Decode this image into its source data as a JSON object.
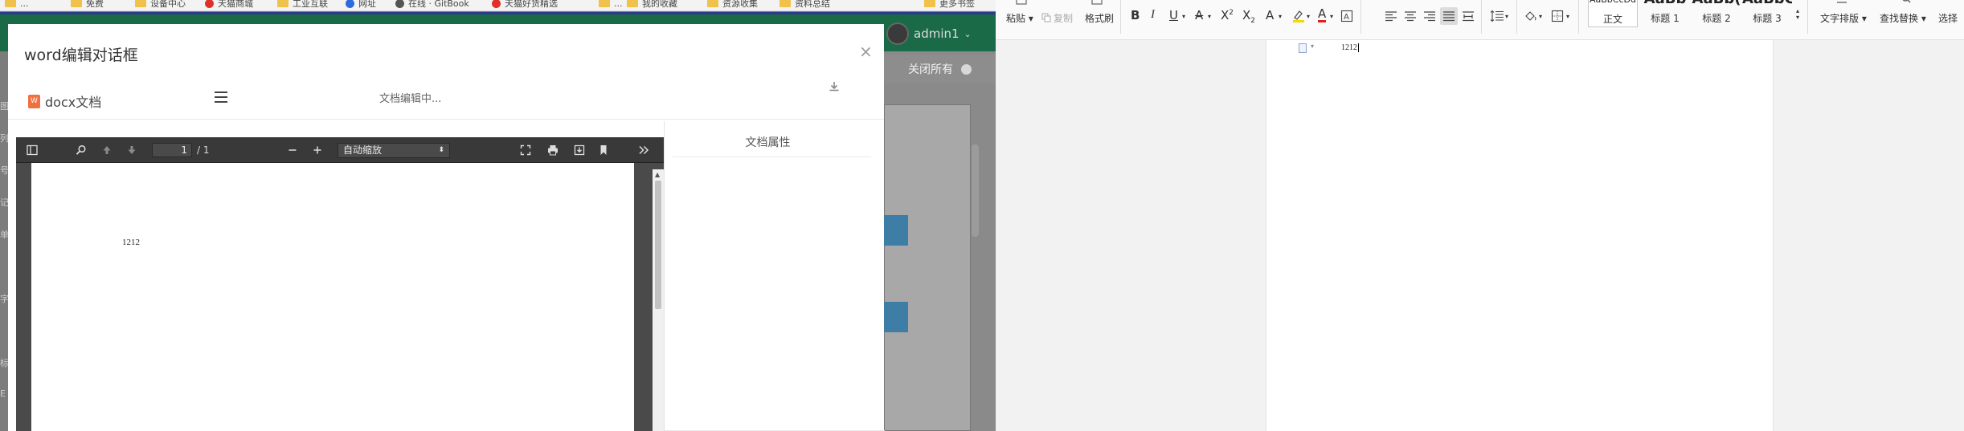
{
  "browser": {
    "bookmarks": [
      {
        "label": "...",
        "type": "folder"
      },
      {
        "label": "免费",
        "type": "folder"
      },
      {
        "label": "设备中心",
        "type": "folder"
      },
      {
        "label": "天猫商城",
        "type": "site"
      },
      {
        "label": "工业互联",
        "type": "folder"
      },
      {
        "label": "网址",
        "type": "site"
      },
      {
        "label": "在线 · GitBook",
        "type": "site"
      },
      {
        "label": "天猫好货精选",
        "type": "site"
      },
      {
        "label": "...",
        "type": "folder"
      },
      {
        "label": "我的收藏",
        "type": "folder"
      },
      {
        "label": "资源收集",
        "type": "folder"
      },
      {
        "label": "资料总结",
        "type": "folder"
      },
      {
        "label": "更多书签",
        "type": "folder"
      }
    ]
  },
  "app": {
    "user": "admin1",
    "close_all": "关闭所有",
    "gutter_chars": [
      "图",
      "列",
      "号",
      "记",
      "单",
      "字",
      "标",
      "E"
    ]
  },
  "dialog": {
    "title": "word编辑对话框",
    "close_glyph": "×",
    "doc_title": "docx文档",
    "status": "文档编辑中...",
    "properties_title": "文档属性"
  },
  "pdf": {
    "page_current": "1",
    "page_total": "/ 1",
    "zoom": "自动缩放",
    "content": "1212"
  },
  "word": {
    "clipboard": {
      "paste": "粘贴",
      "copy": "复制",
      "format_painter": "格式刷"
    },
    "styles": [
      {
        "preview": "AaBbCcDd",
        "label": "正文"
      },
      {
        "preview": "AaBb",
        "label": "标题 1"
      },
      {
        "preview": "AaBb(",
        "label": "标题 2"
      },
      {
        "preview": "AaBbC",
        "label": "标题 3"
      }
    ],
    "layout": "文字排版",
    "find_replace": "查找替换",
    "select": "选择",
    "content": "1212"
  },
  "colors": {
    "header_green": "#1a6a48",
    "pdf_toolbar": "#393939",
    "accent_blue": "#3d7da6"
  }
}
